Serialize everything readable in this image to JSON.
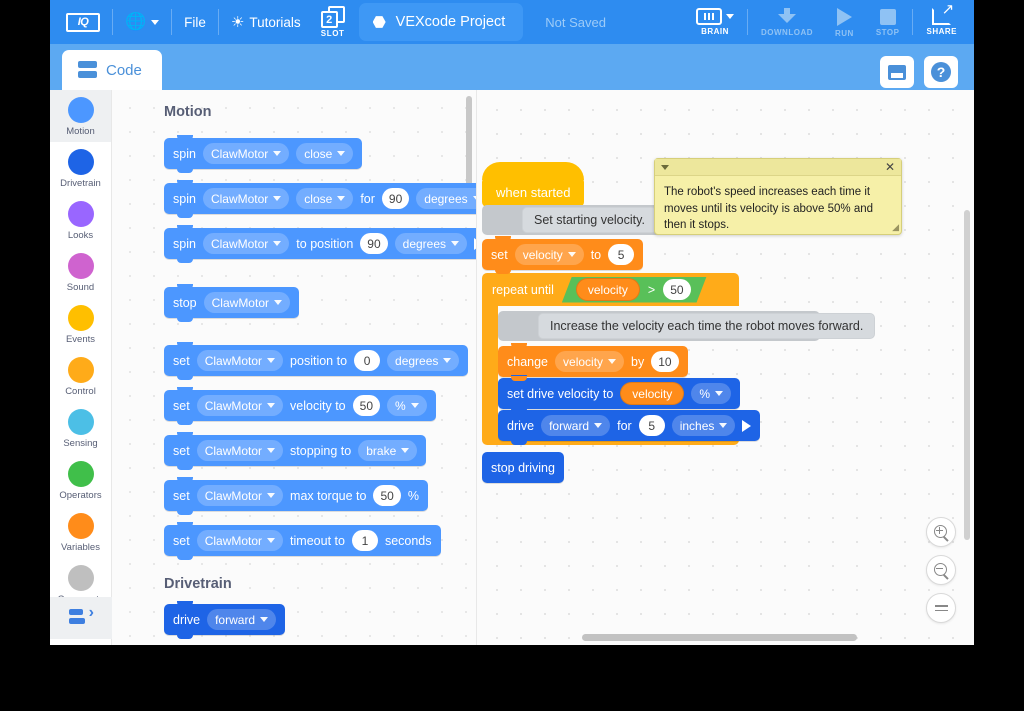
{
  "toolbar": {
    "logo": "IQ",
    "logo_icon": "vex-iq-logo-icon",
    "globe_icon": "globe-icon",
    "file_label": "File",
    "tutorials_label": "Tutorials",
    "tutorials_icon": "lightbulb-icon",
    "slot_number": "2",
    "slot_label": "SLOT",
    "project_name": "VEXcode Project",
    "project_icon": "hexagon-icon",
    "save_status": "Not Saved",
    "actions": [
      {
        "label": "BRAIN",
        "icon": "brain-icon",
        "enabled": true
      },
      {
        "label": "DOWNLOAD",
        "icon": "download-icon",
        "enabled": false
      },
      {
        "label": "RUN",
        "icon": "play-icon",
        "enabled": false
      },
      {
        "label": "STOP",
        "icon": "stop-icon",
        "enabled": false
      },
      {
        "label": "SHARE",
        "icon": "share-icon",
        "enabled": true
      }
    ]
  },
  "tabbar": {
    "code_tab_label": "Code",
    "code_tab_icon": "blocks-icon",
    "device_button_icon": "brain-icon",
    "help_button_icon": "question-mark-icon"
  },
  "categories": [
    {
      "label": "Motion",
      "color": "#4C97FF",
      "selected": true
    },
    {
      "label": "Drivetrain",
      "color": "#1E64E6",
      "selected": false
    },
    {
      "label": "Looks",
      "color": "#9966FF",
      "selected": false
    },
    {
      "label": "Sound",
      "color": "#CF63CF",
      "selected": false
    },
    {
      "label": "Events",
      "color": "#FFBF00",
      "selected": false
    },
    {
      "label": "Control",
      "color": "#FFAB19",
      "selected": false
    },
    {
      "label": "Sensing",
      "color": "#4CBFE6",
      "selected": false
    },
    {
      "label": "Operators",
      "color": "#40BF4A",
      "selected": false
    },
    {
      "label": "Variables",
      "color": "#FF8C1A",
      "selected": false
    },
    {
      "label": "Comments",
      "color": "#BFBFBF",
      "selected": false
    }
  ],
  "code_toggle_icon": "switch-to-text-code-icon",
  "palette": {
    "section_motion": "Motion",
    "section_drivetrain": "Drivetrain",
    "blocks": {
      "spin_dir": {
        "w1": "spin",
        "device": "ClawMotor",
        "dir": "close"
      },
      "spin_for": {
        "w1": "spin",
        "device": "ClawMotor",
        "dir": "close",
        "w2": "for",
        "value": "90",
        "unit": "degrees"
      },
      "spin_to_pos": {
        "w1": "spin",
        "device": "ClawMotor",
        "w2": "to position",
        "value": "90",
        "unit": "degrees"
      },
      "stop_motor": {
        "w1": "stop",
        "device": "ClawMotor"
      },
      "set_position": {
        "w1": "set",
        "device": "ClawMotor",
        "w2": "position to",
        "value": "0",
        "unit": "degrees"
      },
      "set_velocity": {
        "w1": "set",
        "device": "ClawMotor",
        "w2": "velocity to",
        "value": "50",
        "unit": "%"
      },
      "set_stopping": {
        "w1": "set",
        "device": "ClawMotor",
        "w2": "stopping to",
        "mode": "brake"
      },
      "set_torque": {
        "w1": "set",
        "device": "ClawMotor",
        "w2": "max torque to",
        "value": "50",
        "w3": "%"
      },
      "set_timeout": {
        "w1": "set",
        "device": "ClawMotor",
        "w2": "timeout to",
        "value": "1",
        "w3": "seconds"
      },
      "drive_forward": {
        "w1": "drive",
        "dir": "forward"
      }
    }
  },
  "workspace": {
    "hat_label": "when started",
    "comment_1": "Set starting velocity.",
    "comment_2": "Increase the velocity each time the robot moves forward.",
    "set_velocity": {
      "w1": "set",
      "var": "velocity",
      "w2": "to",
      "value": "5"
    },
    "repeat_until": {
      "w1": "repeat until",
      "var": "velocity",
      "op": ">",
      "value": "50"
    },
    "change_velocity": {
      "w1": "change",
      "var": "velocity",
      "w2": "by",
      "value": "10"
    },
    "set_drive_velocity": {
      "w1": "set drive velocity to",
      "var": "velocity",
      "unit": "%"
    },
    "drive_for": {
      "w1": "drive",
      "dir": "forward",
      "w2": "for",
      "value": "5",
      "unit": "inches"
    },
    "stop_driving": {
      "w1": "stop driving"
    },
    "loop_arrow_icon": "loop-arrow-icon"
  },
  "note": {
    "text": "The robot's speed increases each time it moves until its velocity is above 50% and then it stops.",
    "collapse_icon": "collapse-caret-icon",
    "close_icon": "close-icon",
    "resize_icon": "resize-grip-icon"
  },
  "zoom_controls": [
    {
      "name": "zoom-in-button",
      "icon": "magnifier-plus-icon"
    },
    {
      "name": "zoom-out-button",
      "icon": "magnifier-minus-icon"
    },
    {
      "name": "zoom-reset-button",
      "icon": "equals-icon"
    }
  ]
}
